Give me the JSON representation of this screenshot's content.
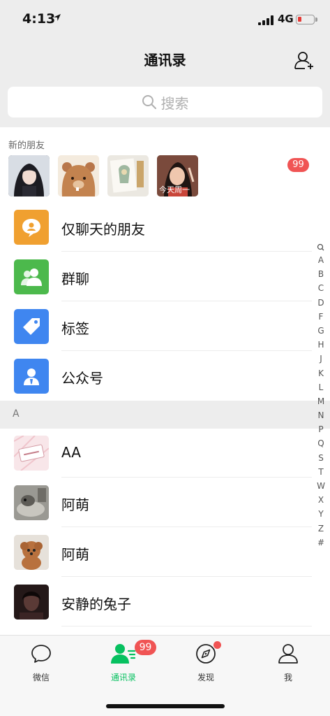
{
  "status_bar": {
    "time": "4:13",
    "network": "4G"
  },
  "header": {
    "title": "通讯录"
  },
  "search": {
    "placeholder": "搜索"
  },
  "new_friends": {
    "title": "新的朋友",
    "badge": "99",
    "avatar_caption": "今天周一"
  },
  "function_rows": [
    {
      "label": "仅聊天的朋友",
      "icon": "chat-bubble-icon",
      "color": "#f0a030"
    },
    {
      "label": "群聊",
      "icon": "group-icon",
      "color": "#4cb94c"
    },
    {
      "label": "标签",
      "icon": "tag-icon",
      "color": "#3f86f0"
    },
    {
      "label": "公众号",
      "icon": "official-account-icon",
      "color": "#3f86f0"
    }
  ],
  "section": {
    "letter": "A"
  },
  "contacts": [
    {
      "name": "AA"
    },
    {
      "name": "阿萌"
    },
    {
      "name": "阿萌"
    },
    {
      "name": "安静的兔子"
    }
  ],
  "index_letters": [
    "A",
    "B",
    "C",
    "D",
    "F",
    "G",
    "H",
    "J",
    "K",
    "L",
    "M",
    "N",
    "P",
    "Q",
    "S",
    "T",
    "W",
    "X",
    "Y",
    "Z",
    "#"
  ],
  "tabs": [
    {
      "label": "微信",
      "icon": "chat-icon"
    },
    {
      "label": "通讯录",
      "icon": "contacts-icon",
      "active": true,
      "badge": "99"
    },
    {
      "label": "发现",
      "icon": "compass-icon",
      "dot": true
    },
    {
      "label": "我",
      "icon": "person-icon"
    }
  ],
  "colors": {
    "accent": "#07c160",
    "badge": "#f05454",
    "background": "#ededed"
  }
}
